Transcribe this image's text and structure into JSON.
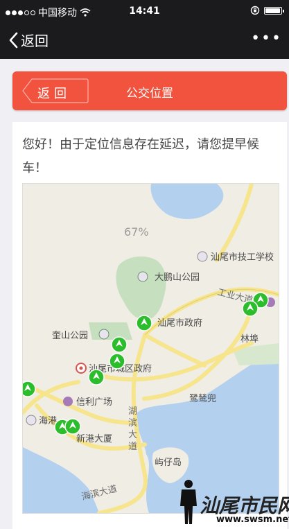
{
  "status_bar": {
    "carrier": "中国移动",
    "time": "14:41"
  },
  "nav": {
    "back_label": "返回",
    "more_label": "•••"
  },
  "header": {
    "back_label": "返回",
    "title": "公交位置"
  },
  "notice": "您好！由于定位信息存在延迟，请您提早候车！",
  "map": {
    "zoom_label": "67%",
    "places": {
      "jigong": "汕尾市技工学校",
      "dapeng": "大鹏山公园",
      "gongye": "工业大道",
      "zhengfu": "汕尾市政府",
      "kuishan": "奎山公园",
      "linfu": "林埠",
      "chengqu": "汕尾市城区政府",
      "xinli": "信利广场",
      "luside": "鹭鸶兜",
      "haigang": "海港",
      "xingang": "新港大厦",
      "hubin": "湖滨大道",
      "yuzi": "屿仔岛",
      "haibin": "海滨大道"
    }
  },
  "watermark": {
    "site_name": "汕尾市民网",
    "url": "www.swsm.net"
  }
}
